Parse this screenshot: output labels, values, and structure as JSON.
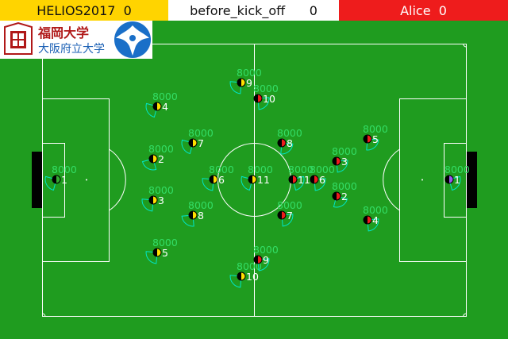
{
  "scoreboard": {
    "left_team": "HELIOS2017",
    "left_score": "0",
    "play_mode": "before_kick_off",
    "time": "0",
    "right_team": "Alice",
    "right_score": "0",
    "left_color": "#ffd400",
    "right_color": "#ee1c1c"
  },
  "logo": {
    "line1": "福岡大学",
    "line2": "大阪府立大学"
  },
  "colors": {
    "field": "#1f9c1f",
    "stamina_text": "#33dd66",
    "left_player": "#ffe000",
    "right_player": "#ee1c1c",
    "goalie_left": "#33aa33",
    "goalie_right": "#9955ee"
  },
  "left_players": [
    {
      "num": "1",
      "stamina": "8000"
    },
    {
      "num": "2",
      "stamina": "8000"
    },
    {
      "num": "3",
      "stamina": "8000"
    },
    {
      "num": "4",
      "stamina": "8000"
    },
    {
      "num": "5",
      "stamina": "8000"
    },
    {
      "num": "6",
      "stamina": "8000"
    },
    {
      "num": "7",
      "stamina": "8000"
    },
    {
      "num": "8",
      "stamina": "8000"
    },
    {
      "num": "9",
      "stamina": "8000"
    },
    {
      "num": "10",
      "stamina": "8000"
    },
    {
      "num": "11",
      "stamina": "8000"
    }
  ],
  "right_players": [
    {
      "num": "1",
      "stamina": "8000"
    },
    {
      "num": "2",
      "stamina": "8000"
    },
    {
      "num": "3",
      "stamina": "8000"
    },
    {
      "num": "4",
      "stamina": "8000"
    },
    {
      "num": "5",
      "stamina": "8000"
    },
    {
      "num": "6",
      "stamina": "8000"
    },
    {
      "num": "7",
      "stamina": "8000"
    },
    {
      "num": "8",
      "stamina": "8000"
    },
    {
      "num": "9",
      "stamina": "8000"
    },
    {
      "num": "10",
      "stamina": "8000"
    },
    {
      "num": "11",
      "stamina": "8000"
    }
  ]
}
